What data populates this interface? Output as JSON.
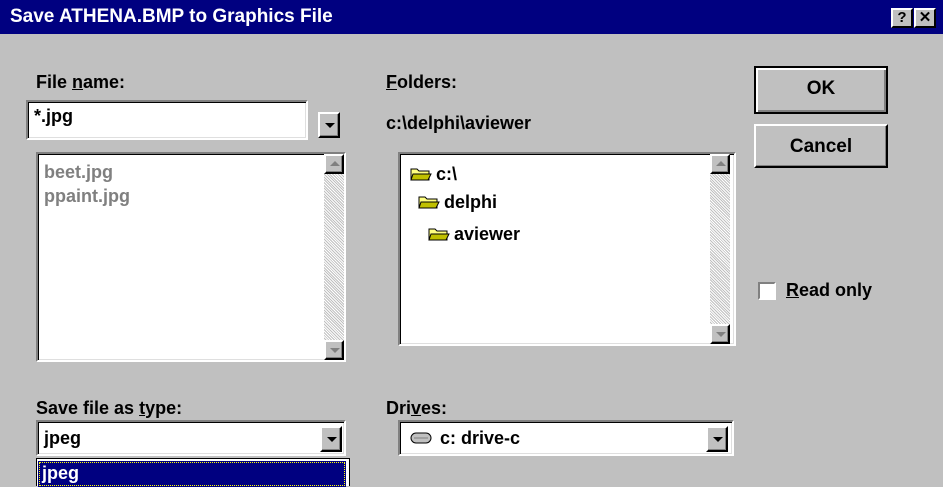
{
  "window": {
    "title": "Save ATHENA.BMP to Graphics File",
    "help_glyph": "?",
    "close_glyph": "✕"
  },
  "file_name": {
    "label_pre": "File ",
    "label_ul": "n",
    "label_post": "ame:",
    "value": "*.jpg",
    "files": [
      "beet.jpg",
      "ppaint.jpg"
    ]
  },
  "folders": {
    "label_ul": "F",
    "label_post": "olders:",
    "current_path": "c:\\delphi\\aviewer",
    "items": [
      "c:\\",
      "delphi",
      "aviewer"
    ]
  },
  "file_type": {
    "label_pre": "Save file as ",
    "label_ul": "t",
    "label_post": "ype:",
    "value": "jpeg",
    "dropdown_selected": "jpeg"
  },
  "drives": {
    "label_pre": "Dri",
    "label_ul": "v",
    "label_post": "es:",
    "value": "c: drive-c"
  },
  "buttons": {
    "ok": "OK",
    "cancel": "Cancel"
  },
  "read_only": {
    "label_ul": "R",
    "label_post": "ead only",
    "checked": false
  },
  "icons": {
    "folder": "folder-open-icon",
    "drive": "hard-drive-icon",
    "dropdown": "chevron-down-icon"
  },
  "colors": {
    "titlebar": "#000080",
    "face": "#c0c0c0",
    "selection": "#000080",
    "disabled_text": "#808080"
  }
}
